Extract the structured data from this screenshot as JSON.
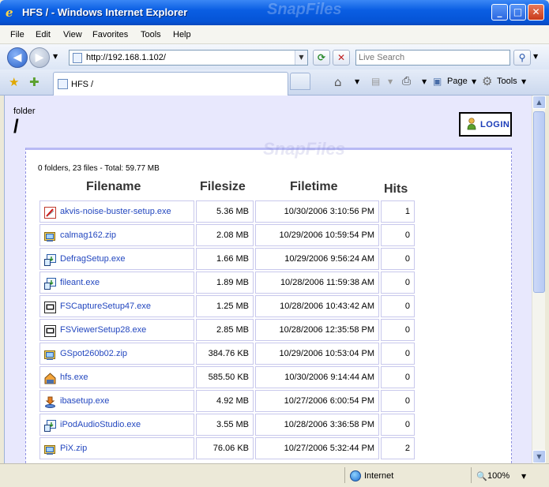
{
  "window": {
    "title": "HFS / - Windows Internet Explorer",
    "watermark": "SnapFiles"
  },
  "menu": [
    "File",
    "Edit",
    "View",
    "Favorites",
    "Tools",
    "Help"
  ],
  "address": {
    "url": "http://192.168.1.102/"
  },
  "search": {
    "placeholder": "Live Search"
  },
  "tab": {
    "label": "HFS /"
  },
  "toolbar": {
    "page": "Page",
    "tools": "Tools"
  },
  "status": {
    "zone": "Internet",
    "zoom": "100%"
  },
  "page": {
    "folder_label": "folder",
    "folder_name": "/",
    "login": "LOGIN",
    "summary": "0 folders, 23 files - Total: 59.77 MB",
    "watermark": "SnapFiles",
    "headers": {
      "filename": "Filename",
      "filesize": "Filesize",
      "filetime": "Filetime",
      "hits": "Hits"
    },
    "files": [
      {
        "name": "akvis-noise-buster-setup.exe",
        "size": "5.36 MB",
        "time": "10/30/2006 3:10:56 PM",
        "hits": "1",
        "icon": "akvis-icon"
      },
      {
        "name": "calmag162.zip",
        "size": "2.08 MB",
        "time": "10/29/2006 10:59:54 PM",
        "hits": "0",
        "icon": "zip-icon"
      },
      {
        "name": "DefragSetup.exe",
        "size": "1.66 MB",
        "time": "10/29/2006 9:56:24 AM",
        "hits": "0",
        "icon": "installer-icon"
      },
      {
        "name": "fileant.exe",
        "size": "1.89 MB",
        "time": "10/28/2006 11:59:38 AM",
        "hits": "0",
        "icon": "installer-icon"
      },
      {
        "name": "FSCaptureSetup47.exe",
        "size": "1.25 MB",
        "time": "10/28/2006 10:43:42 AM",
        "hits": "0",
        "icon": "app-icon"
      },
      {
        "name": "FSViewerSetup28.exe",
        "size": "2.85 MB",
        "time": "10/28/2006 12:35:58 PM",
        "hits": "0",
        "icon": "app-icon"
      },
      {
        "name": "GSpot260b02.zip",
        "size": "384.76 KB",
        "time": "10/29/2006 10:53:04 PM",
        "hits": "0",
        "icon": "zip-icon"
      },
      {
        "name": "hfs.exe",
        "size": "585.50 KB",
        "time": "10/30/2006 9:14:44 AM",
        "hits": "0",
        "icon": "hfs-icon"
      },
      {
        "name": "ibasetup.exe",
        "size": "4.92 MB",
        "time": "10/27/2006 6:00:54 PM",
        "hits": "0",
        "icon": "setup-icon"
      },
      {
        "name": "iPodAudioStudio.exe",
        "size": "3.55 MB",
        "time": "10/28/2006 3:36:58 PM",
        "hits": "0",
        "icon": "installer-icon"
      },
      {
        "name": "PiX.zip",
        "size": "76.06 KB",
        "time": "10/27/2006 5:32:44 PM",
        "hits": "2",
        "icon": "zip-icon"
      }
    ]
  }
}
